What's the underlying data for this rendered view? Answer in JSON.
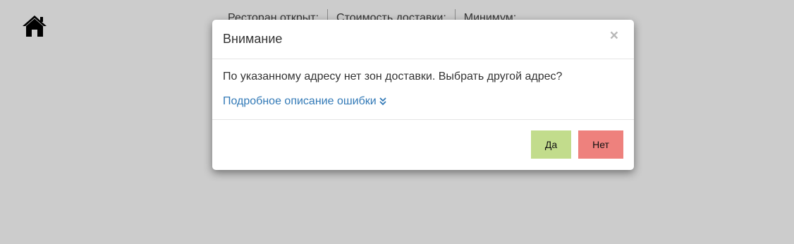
{
  "header": {
    "home_icon": "home-icon",
    "info": {
      "restaurant_open_label": "Ресторан открыт:",
      "delivery_cost_label": "Стоимость доставки:",
      "minimum_label": "Минимум:"
    }
  },
  "modal": {
    "title": "Внимание",
    "close_label": "×",
    "message": "По указанному адресу нет зон доставки. Выбрать другой адрес?",
    "details_link": "Подробное описание ошибки",
    "details_icon": "double-chevron-down-icon",
    "yes_label": "Да",
    "no_label": "Нет"
  },
  "colors": {
    "backdrop": "#cccccc",
    "link": "#337ab7",
    "yes_button": "#c2dc8c",
    "no_button": "#ee817d"
  }
}
